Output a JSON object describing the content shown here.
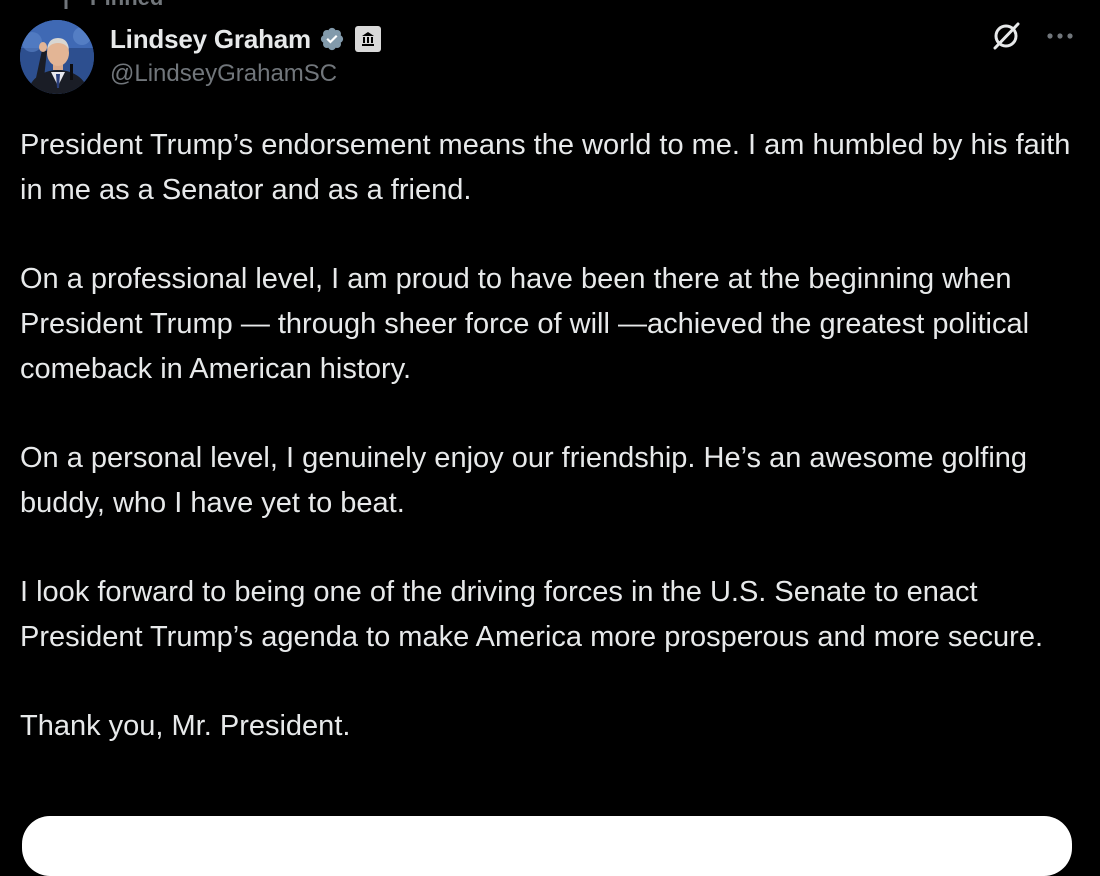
{
  "pinned": {
    "label": "Pinned",
    "icon": "pin-icon"
  },
  "author": {
    "display_name": "Lindsey Graham",
    "handle": "@LindseyGrahamSC",
    "verified_icon": "verified-badge-icon",
    "verified_color": "#1d9bf0",
    "affiliation_icon": "government-building-icon"
  },
  "actions": {
    "grok_icon": "grok-icon",
    "more_icon": "more-icon"
  },
  "tweet": {
    "paragraphs": [
      "President Trump’s endorsement means the world to me. I am humbled by his faith in me as a Senator and as a friend.",
      "On a professional level, I am proud to have been there at the beginning when President Trump — through sheer force of will —achieved the greatest political comeback in American history.",
      "On a personal level, I genuinely enjoy our friendship. He’s an awesome golfing buddy, who I have yet to beat.",
      "I look forward to being one of the driving forces in the U.S. Senate to enact President Trump’s agenda to make America more prosperous and more secure.",
      "Thank you, Mr. President."
    ]
  },
  "colors": {
    "background": "#000000",
    "text_primary": "#e7e9ea",
    "text_secondary": "#71767b"
  }
}
